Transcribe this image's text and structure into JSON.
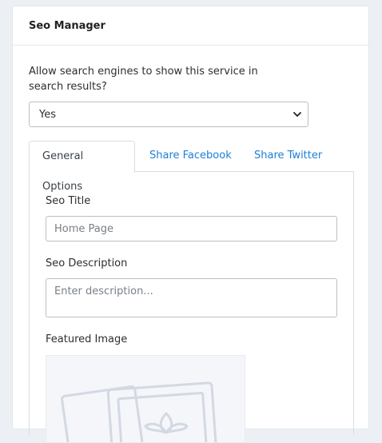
{
  "card": {
    "title": "Seo Manager"
  },
  "visibility": {
    "question": "Allow search engines to show this service in search results?",
    "selected": "Yes"
  },
  "tabs": [
    {
      "label": "General Options",
      "active": true
    },
    {
      "label": "Share Facebook",
      "active": false
    },
    {
      "label": "Share Twitter",
      "active": false
    }
  ],
  "general": {
    "seo_title_label": "Seo Title",
    "seo_title_placeholder": "Home Page",
    "seo_description_label": "Seo Description",
    "seo_description_placeholder": "Enter description...",
    "featured_image_label": "Featured Image",
    "featured_image_icon": "image-placeholder-icon"
  },
  "colors": {
    "link": "#1c7fd6",
    "background": "#eceff3"
  }
}
